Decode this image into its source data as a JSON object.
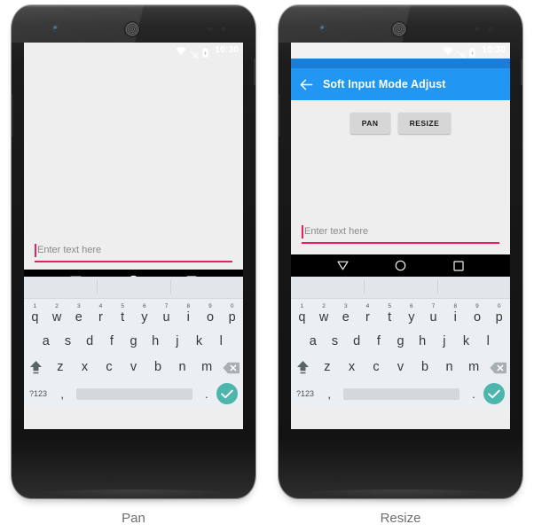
{
  "figures": [
    {
      "caption": "Pan",
      "mode": "pan",
      "show_appbar": false,
      "status": {
        "time": "10:30",
        "wifi_icon": "wifi-icon",
        "signal_icon": "signal-off-icon",
        "battery_icon": "battery-icon"
      },
      "appbar": {
        "title": "",
        "back_icon": "back-arrow-icon"
      },
      "buttons": [],
      "edittext": {
        "hint": "Enter text here",
        "value": ""
      }
    },
    {
      "caption": "Resize",
      "mode": "resize",
      "show_appbar": true,
      "status": {
        "time": "10:30",
        "wifi_icon": "wifi-icon",
        "signal_icon": "signal-off-icon",
        "battery_icon": "battery-icon"
      },
      "appbar": {
        "title": "Soft Input Mode Adjust",
        "back_icon": "back-arrow-icon"
      },
      "buttons": [
        {
          "label": "PAN"
        },
        {
          "label": "RESIZE"
        }
      ],
      "edittext": {
        "hint": "Enter text here",
        "value": ""
      }
    }
  ],
  "keyboard": {
    "row1": [
      {
        "key": "q",
        "num": "1"
      },
      {
        "key": "w",
        "num": "2"
      },
      {
        "key": "e",
        "num": "3"
      },
      {
        "key": "r",
        "num": "4"
      },
      {
        "key": "t",
        "num": "5"
      },
      {
        "key": "y",
        "num": "6"
      },
      {
        "key": "u",
        "num": "7"
      },
      {
        "key": "i",
        "num": "8"
      },
      {
        "key": "o",
        "num": "9"
      },
      {
        "key": "p",
        "num": "0"
      }
    ],
    "row2": [
      {
        "key": "a"
      },
      {
        "key": "s"
      },
      {
        "key": "d"
      },
      {
        "key": "f"
      },
      {
        "key": "g"
      },
      {
        "key": "h"
      },
      {
        "key": "j"
      },
      {
        "key": "k"
      },
      {
        "key": "l"
      }
    ],
    "row3": [
      {
        "key": "z"
      },
      {
        "key": "x"
      },
      {
        "key": "c"
      },
      {
        "key": "v"
      },
      {
        "key": "b"
      },
      {
        "key": "n"
      },
      {
        "key": "m"
      }
    ],
    "shift_icon": "shift-icon",
    "delete_icon": "backspace-icon",
    "symbols_label": "?123",
    "comma_label": ",",
    "period_label": ".",
    "enter_icon": "checkmark-icon",
    "space_label": ""
  },
  "navbar": {
    "back_icon": "nav-back-triangle-icon",
    "home_icon": "nav-home-circle-icon",
    "recents_icon": "nav-recents-square-icon"
  },
  "colors": {
    "appbar": "#2196f3",
    "statusbar_blue": "#1a7fd4",
    "accent_pink": "#e91e63",
    "enter_teal": "#4db6ac",
    "screen_bg": "#eeeeee",
    "keyboard_bg": "#eceff1",
    "suggestion_bg": "#e2e6e8",
    "button_gray": "#d6d6d6",
    "caption_gray": "#6e6e6e"
  }
}
